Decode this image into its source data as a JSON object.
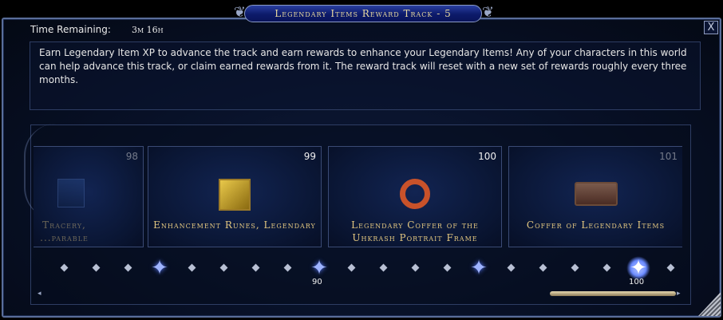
{
  "window": {
    "title": "Legendary Items Reward Track - 5",
    "close_label": "X"
  },
  "time": {
    "label": "Time Remaining:",
    "value": "3m 16h"
  },
  "description": "Earn Legendary Item XP to advance the track and earn rewards to enhance your Legendary Items! Any of your characters in this world can help advance this track, or claim earned rewards from it. The reward track will reset with a new set of rewards roughly every three months.",
  "rewards": [
    {
      "level": "98",
      "name": "Tracery, ...parable",
      "icon": "tracery-icon"
    },
    {
      "level": "99",
      "name": "Enhancement Runes, Legendary",
      "icon": "runes-icon"
    },
    {
      "level": "100",
      "name": "Legendary Coffer of the Uhkrash Portrait Frame",
      "icon": "portrait-frame-icon"
    },
    {
      "level": "101",
      "name": "Coffer of Legendary Items",
      "icon": "chest-icon"
    }
  ],
  "track": {
    "marker_90": "90",
    "marker_100": "100"
  },
  "scrollbar": {
    "left_arrow": "◂",
    "right_arrow": "▸"
  }
}
